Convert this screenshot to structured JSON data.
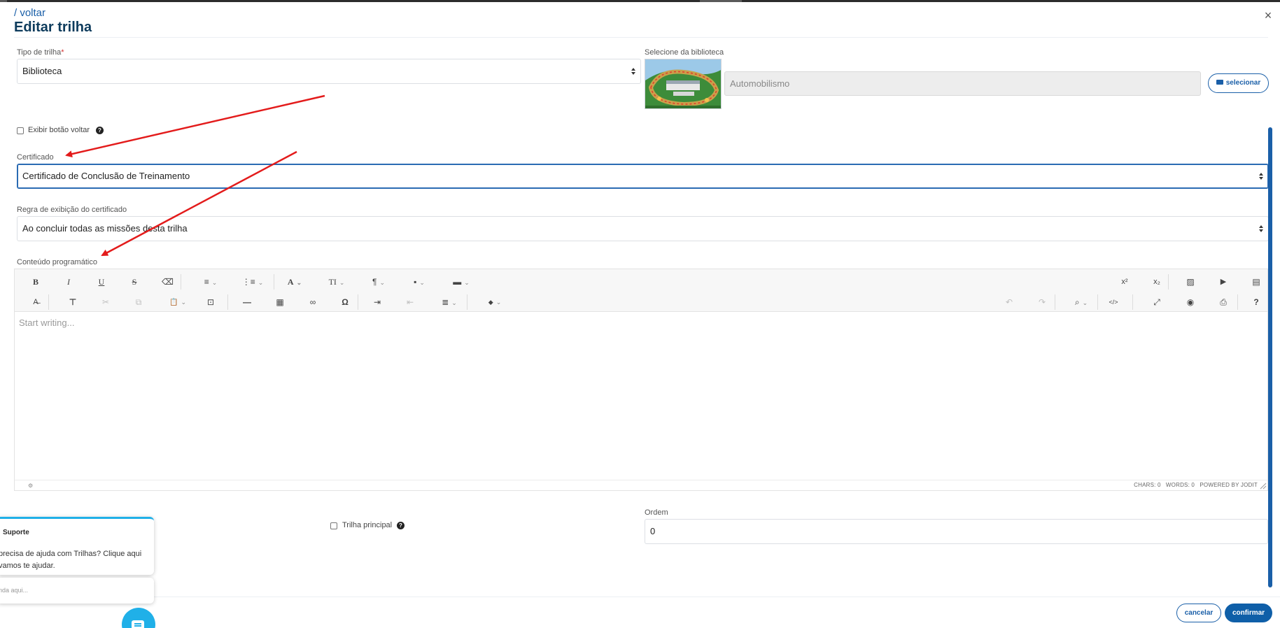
{
  "header": {
    "back_link": "/ voltar",
    "title": "Editar trilha",
    "close_glyph": "×"
  },
  "form": {
    "tipo_label": "Tipo de trilha",
    "tipo_required": "*",
    "tipo_value": "Biblioteca",
    "biblioteca_label": "Selecione da biblioteca",
    "biblioteca_value": "Automobilismo",
    "selecionar_button": "selecionar",
    "exibir_voltar_label": "Exibir botão voltar",
    "exibir_voltar_checked": false,
    "certificado_label": "Certificado",
    "certificado_value": "Certificado de Conclusão de Treinamento",
    "regra_label": "Regra de exibição do certificado",
    "regra_value": "Ao concluir todas as missões desta trilha",
    "conteudo_label": "Conteúdo programático",
    "trilha_principal_label": "Trilha principal",
    "trilha_principal_checked": false,
    "ordem_label": "Ordem",
    "ordem_value": "0"
  },
  "editor": {
    "placeholder": "Start writing...",
    "chars": "CHARS: 0",
    "words": "WORDS: 0",
    "powered": "POWERED BY JODIT",
    "toolbar_row1": {
      "bold": "B",
      "italic": "I",
      "underline": "U",
      "strike": "S",
      "eraser": "⌫",
      "ul": "≡",
      "ol": "⋮≡",
      "font": "A",
      "size": "TI",
      "paragraph": "¶",
      "classname": "▪",
      "lineheight": "▬",
      "superscript": "x²",
      "subscript": "x₂",
      "image": "▨",
      "video": "▶",
      "file": "▤"
    },
    "toolbar_row2": {
      "spellcheck": "A̶",
      "format_painter": "⊤",
      "cut": "✂",
      "copy": "⧉",
      "paste": "📋",
      "select_all": "⊡",
      "hr": "—",
      "table": "▦",
      "link": "∞",
      "symbols": "Ω",
      "indent": "⇥",
      "outdent": "⇤",
      "align": "≣",
      "brush": "◆",
      "undo": "↶",
      "redo": "↷",
      "find": "⌕",
      "source": "</>",
      "fullsize": "⤢",
      "preview": "◉",
      "print": "⎙",
      "about": "?"
    }
  },
  "footer": {
    "cancel": "cancelar",
    "confirm": "confirmar"
  },
  "chat": {
    "title": "Suporte",
    "message_line1": "precisa de ajuda com Trilhas? Clique aqui",
    "message_line2": "vamos te ajudar.",
    "input_placeholder": "nda aqui..."
  },
  "colors": {
    "primary": "#0f5fa8",
    "accent_chat": "#20b0e8",
    "annotation_arrow": "#e31b1b"
  }
}
